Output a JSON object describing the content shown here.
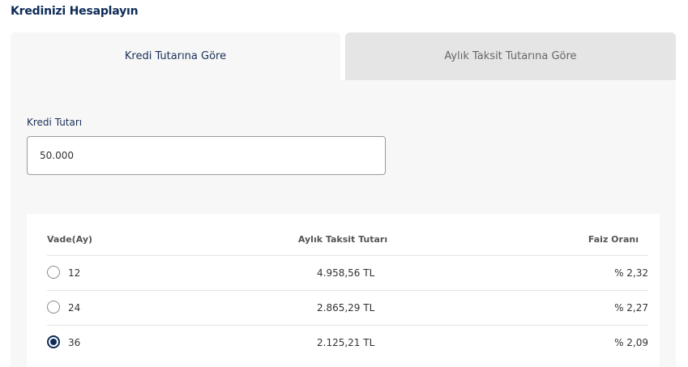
{
  "page": {
    "title": "Kredinizi Hesaplayın"
  },
  "tabs": [
    {
      "label": "Kredi Tutarına Göre",
      "active": true
    },
    {
      "label": "Aylık Taksit Tutarına Göre",
      "active": false
    }
  ],
  "form": {
    "amount_label": "Kredi Tutarı",
    "amount_value": "50.000"
  },
  "table": {
    "headers": {
      "term": "Vade(Ay)",
      "monthly": "Aylık Taksit Tutarı",
      "rate": "Faiz Oranı"
    },
    "rows": [
      {
        "term": "12",
        "monthly": "4.958,56 TL",
        "rate": "% 2,32",
        "selected": false
      },
      {
        "term": "24",
        "monthly": "2.865,29 TL",
        "rate": "% 2,27",
        "selected": false
      },
      {
        "term": "36",
        "monthly": "2.125,21 TL",
        "rate": "% 2,09",
        "selected": true
      }
    ]
  },
  "colors": {
    "accent": "#0d2b57",
    "panel_bg": "#f7f7f7",
    "inactive_tab_bg": "#e5e5e5"
  }
}
